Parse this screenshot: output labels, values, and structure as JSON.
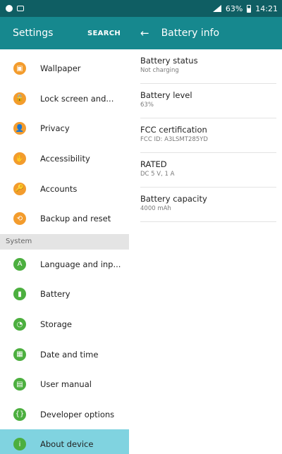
{
  "status_bar": {
    "battery_percent": "63%",
    "time": "14:21"
  },
  "settings_panel": {
    "title": "Settings",
    "search_label": "SEARCH",
    "items_top": [
      {
        "label": "Wallpaper",
        "icon": "wallpaper-icon",
        "glyph": "▣"
      },
      {
        "label": "Lock screen and...",
        "icon": "lock-icon",
        "glyph": "🔒"
      },
      {
        "label": "Privacy",
        "icon": "privacy-icon",
        "glyph": "👤"
      },
      {
        "label": "Accessibility",
        "icon": "accessibility-icon",
        "glyph": "✋"
      },
      {
        "label": "Accounts",
        "icon": "key-icon",
        "glyph": "🔑"
      },
      {
        "label": "Backup and reset",
        "icon": "backup-icon",
        "glyph": "⟲"
      }
    ],
    "section_system": "System",
    "items_system": [
      {
        "label": "Language and inp...",
        "icon": "language-icon",
        "glyph": "A"
      },
      {
        "label": "Battery",
        "icon": "battery-icon",
        "glyph": "▮"
      },
      {
        "label": "Storage",
        "icon": "storage-icon",
        "glyph": "◔"
      },
      {
        "label": "Date and time",
        "icon": "calendar-icon",
        "glyph": "▦"
      },
      {
        "label": "User manual",
        "icon": "manual-icon",
        "glyph": "▤"
      },
      {
        "label": "Developer options",
        "icon": "developer-icon",
        "glyph": "{}"
      },
      {
        "label": "About device",
        "icon": "info-icon",
        "glyph": "i"
      }
    ],
    "selected": "About device"
  },
  "battery_info": {
    "title": "Battery info",
    "rows": [
      {
        "title": "Battery status",
        "value": "Not charging"
      },
      {
        "title": "Battery level",
        "value": "63%"
      },
      {
        "title": "FCC certification",
        "value": "FCC ID: A3LSMT285YD"
      },
      {
        "title": "RATED",
        "value": "DC 5 V, 1 A"
      },
      {
        "title": "Battery capacity",
        "value": "4000 mAh"
      }
    ]
  },
  "colors": {
    "status_bar": "#0f5e63",
    "header": "#16888e",
    "selected_row": "#80d3e0",
    "orange_icon": "#f39c2d",
    "green_icon": "#4caf3f"
  }
}
